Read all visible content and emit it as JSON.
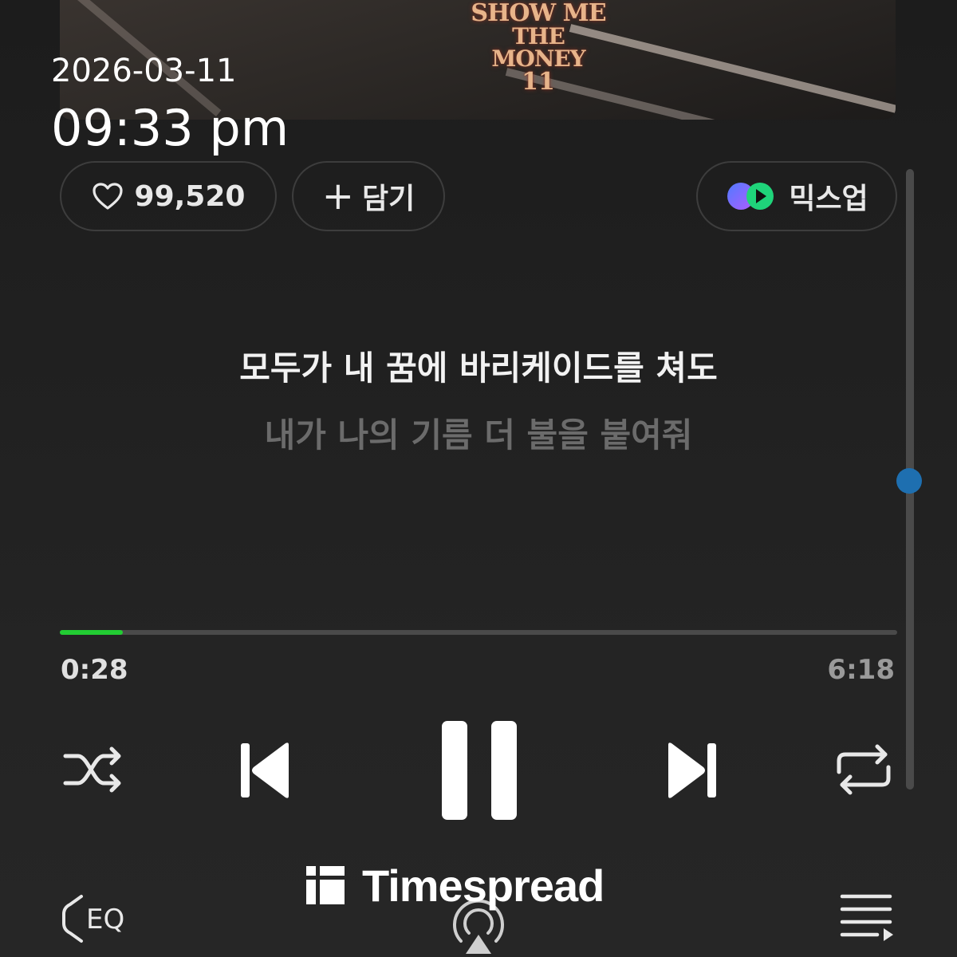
{
  "album": {
    "logo_lines": [
      "SHOW ME",
      "THE MONEY",
      "11"
    ]
  },
  "overlay": {
    "date": "2026-03-11",
    "time": "09:33 pm"
  },
  "actions": {
    "like_count": "99,520",
    "add_label": "담기",
    "mixup_label": "믹스업"
  },
  "lyrics": {
    "current": "모두가 내 꿈에 바리케이드를 쳐도",
    "next": "내가 나의 기름 더 불을 붙여줘"
  },
  "playback": {
    "elapsed": "0:28",
    "total": "6:18",
    "progress_fraction": 0.075
  },
  "controls": {
    "icons": [
      "shuffle-icon",
      "previous-icon",
      "pause-icon",
      "next-icon",
      "repeat-icon"
    ]
  },
  "bottom_bar": {
    "eq_label": "EQ",
    "icons": [
      "eq-icon",
      "airplay-icon",
      "queue-icon"
    ]
  },
  "watermark": {
    "text": "Timespread"
  },
  "colors": {
    "background": "#202020",
    "progress_fill": "#22cc33",
    "scroll_thumb": "#1e6fb0",
    "lyric_current": "#f2f2f2",
    "lyric_next": "#6b6b6b"
  }
}
